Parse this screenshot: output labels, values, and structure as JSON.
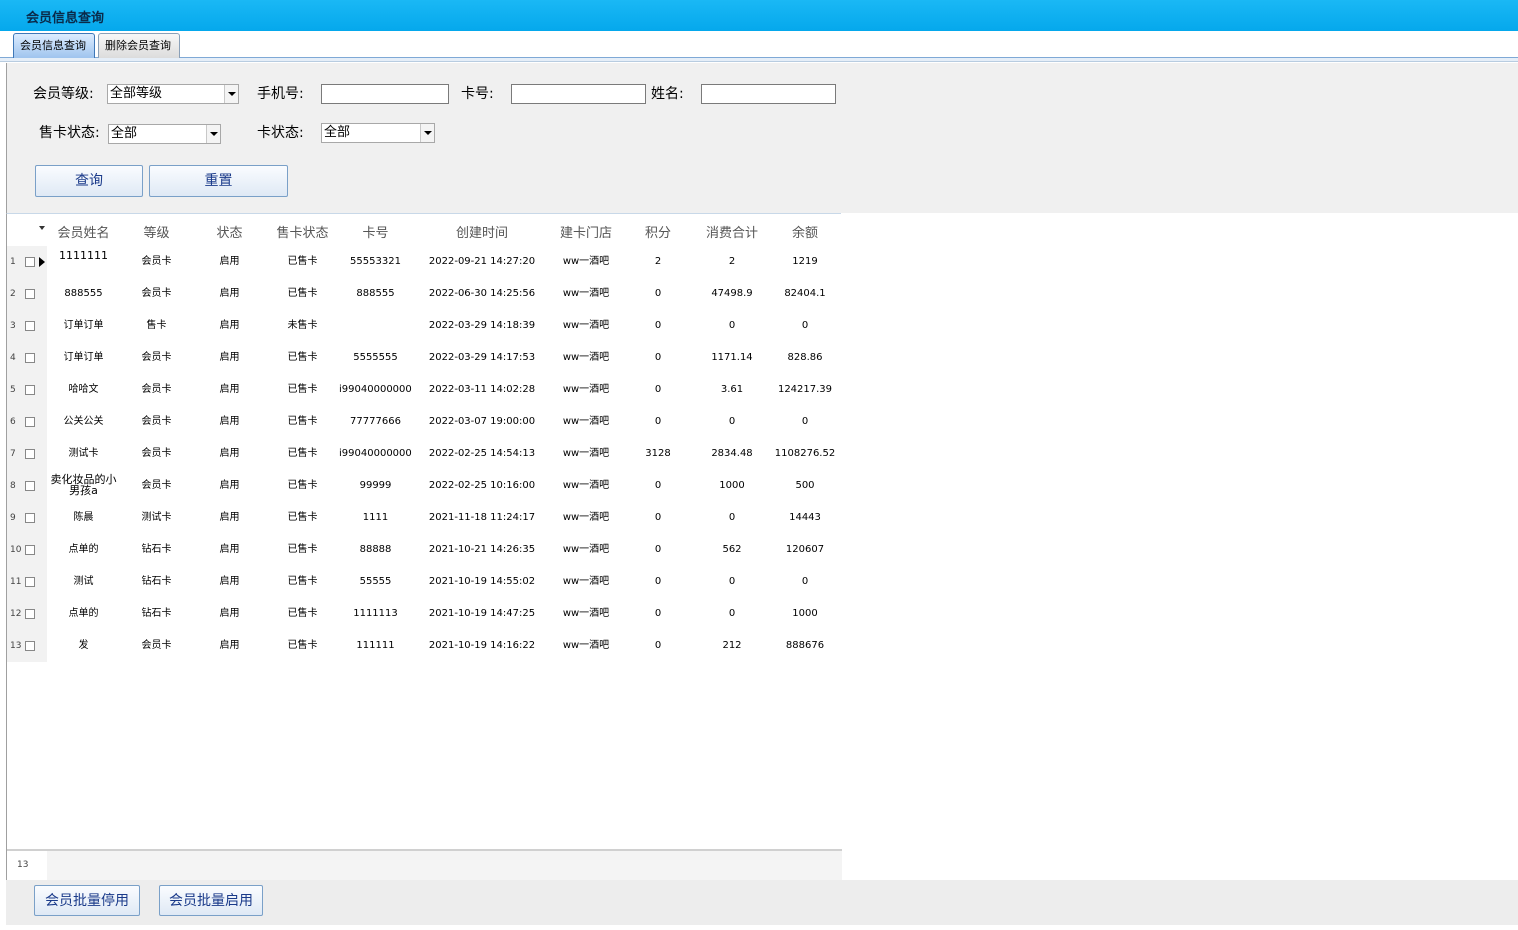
{
  "window": {
    "title": "会员信息查询"
  },
  "tabs": [
    {
      "label": "会员信息查询",
      "active": true
    },
    {
      "label": "删除会员查询",
      "active": false
    }
  ],
  "filters": {
    "level_label": "会员等级:",
    "level_value": "全部等级",
    "phone_label": "手机号:",
    "phone_value": "",
    "card_label": "卡号:",
    "card_value": "",
    "name_label": "姓名:",
    "name_value": "",
    "sale_status_label": "售卡状态:",
    "sale_status_value": "全部",
    "card_status_label": "卡状态:",
    "card_status_value": "全部",
    "query_button": "查询",
    "reset_button": "重置"
  },
  "table": {
    "columns": [
      "会员姓名",
      "等级",
      "状态",
      "售卡状态",
      "卡号",
      "创建时间",
      "建卡门店",
      "积分",
      "消费合计",
      "余额"
    ],
    "rows": [
      {
        "num": "1",
        "cells": [
          "1111111",
          "会员卡",
          "启用",
          "已售卡",
          "55553321",
          "2022-09-21 14:27:20",
          "ww一酒吧",
          "2",
          "2",
          "1219"
        ]
      },
      {
        "num": "2",
        "cells": [
          "888555",
          "会员卡",
          "启用",
          "已售卡",
          "888555",
          "2022-06-30 14:25:56",
          "ww一酒吧",
          "0",
          "47498.9",
          "82404.1"
        ]
      },
      {
        "num": "3",
        "cells": [
          "订单订单",
          "售卡",
          "启用",
          "未售卡",
          "",
          "2022-03-29 14:18:39",
          "ww一酒吧",
          "0",
          "0",
          "0"
        ]
      },
      {
        "num": "4",
        "cells": [
          "订单订单",
          "会员卡",
          "启用",
          "已售卡",
          "5555555",
          "2022-03-29 14:17:53",
          "ww一酒吧",
          "0",
          "1171.14",
          "828.86"
        ]
      },
      {
        "num": "5",
        "cells": [
          "哈哈文",
          "会员卡",
          "启用",
          "已售卡",
          "i990400000000",
          "2022-03-11 14:02:28",
          "ww一酒吧",
          "0",
          "3.61",
          "124217.39"
        ]
      },
      {
        "num": "6",
        "cells": [
          "公关公关",
          "会员卡",
          "启用",
          "已售卡",
          "77777666",
          "2022-03-07 19:00:00",
          "ww一酒吧",
          "0",
          "0",
          "0"
        ]
      },
      {
        "num": "7",
        "cells": [
          "测试卡",
          "会员卡",
          "启用",
          "已售卡",
          "i990400000000",
          "2022-02-25 14:54:13",
          "ww一酒吧",
          "3128",
          "2834.48",
          "1108276.52"
        ]
      },
      {
        "num": "8",
        "cells": [
          "卖化妆品的小男孩a",
          "会员卡",
          "启用",
          "已售卡",
          "99999",
          "2022-02-25 10:16:00",
          "ww一酒吧",
          "0",
          "1000",
          "500"
        ]
      },
      {
        "num": "9",
        "cells": [
          "陈晨",
          "测试卡",
          "启用",
          "已售卡",
          "1111",
          "2021-11-18 11:24:17",
          "ww一酒吧",
          "0",
          "0",
          "14443"
        ]
      },
      {
        "num": "10",
        "cells": [
          "点单的",
          "钻石卡",
          "启用",
          "已售卡",
          "88888",
          "2021-10-21 14:26:35",
          "ww一酒吧",
          "0",
          "562",
          "120607"
        ]
      },
      {
        "num": "11",
        "cells": [
          "测试",
          "钻石卡",
          "启用",
          "已售卡",
          "55555",
          "2021-10-19 14:55:02",
          "ww一酒吧",
          "0",
          "0",
          "0"
        ]
      },
      {
        "num": "12",
        "cells": [
          "点单的",
          "钻石卡",
          "启用",
          "已售卡",
          "1111113",
          "2021-10-19 14:47:25",
          "ww一酒吧",
          "0",
          "0",
          "1000"
        ]
      },
      {
        "num": "13",
        "cells": [
          "发",
          "会员卡",
          "启用",
          "已售卡",
          "111111",
          "2021-10-19 14:16:22",
          "ww一酒吧",
          "0",
          "212",
          "888676"
        ]
      }
    ],
    "row_count": "13"
  },
  "actions": {
    "batch_disable": "会员批量停用",
    "batch_enable": "会员批量启用"
  }
}
